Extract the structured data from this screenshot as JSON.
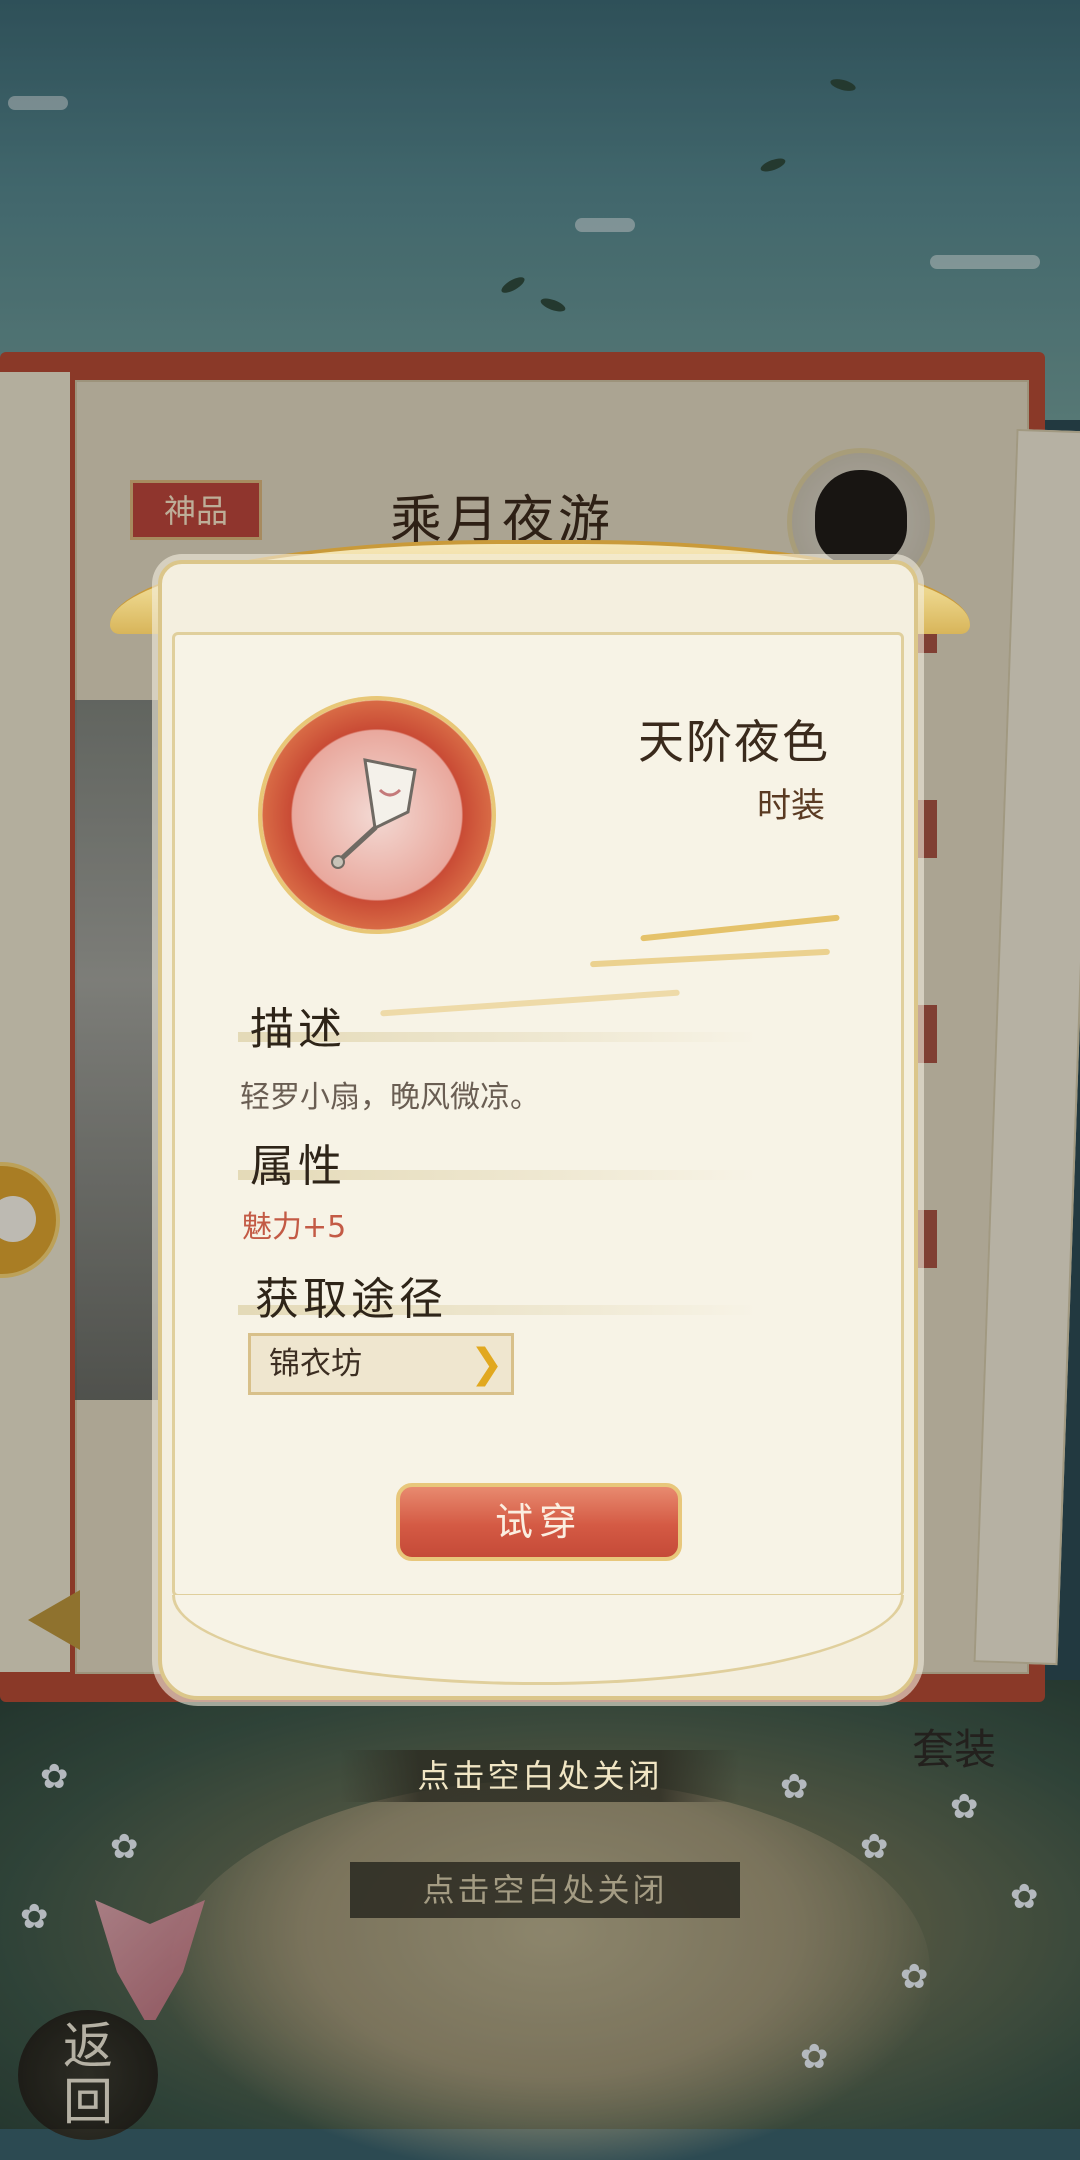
{
  "album": {
    "rarity": "神品",
    "title": "乘月夜游",
    "suit_label": "套装",
    "close_hint": "点击空白处关闭",
    "return_label": "返回"
  },
  "item": {
    "name": "天阶夜色",
    "type": "时装",
    "icon": "fan-icon",
    "description_title": "描述",
    "description": "轻罗小扇，晚风微凉。",
    "attribute_title": "属性",
    "attribute": "魅力+5",
    "source_title": "获取途径",
    "source": "锦衣坊",
    "try_on_label": "试穿"
  },
  "colors": {
    "frame_red": "#b14a34",
    "gold": "#dbc68a",
    "attribute_red": "#c35a45",
    "button_red": "#d45a44"
  }
}
